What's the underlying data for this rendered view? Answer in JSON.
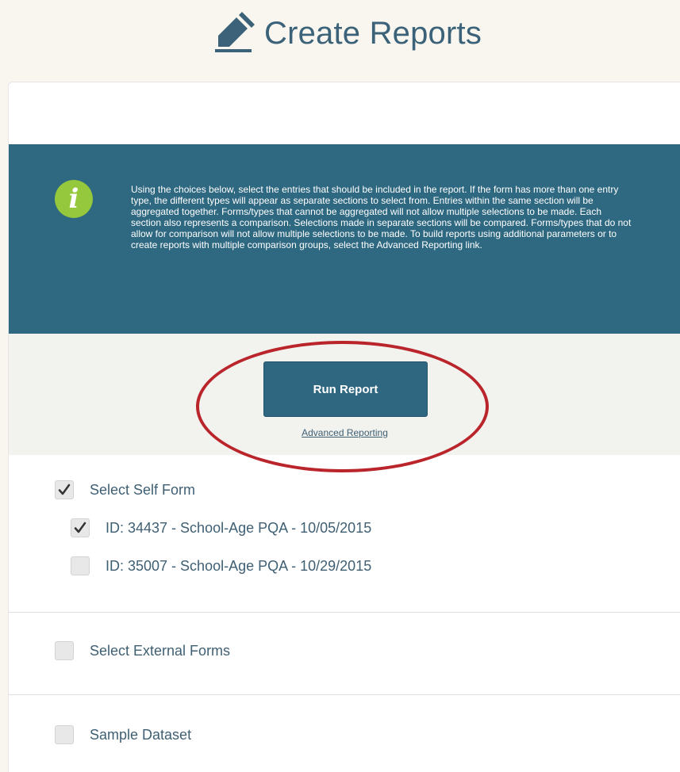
{
  "header": {
    "title": "Create Reports",
    "icon": "pencil-icon"
  },
  "info_box": {
    "icon": "info-icon",
    "icon_glyph": "i",
    "text": "Using the choices below, select the entries that should be included in the report. If the form has more than one entry type, the different types will appear as separate sections to select from. Entries within the same section will be aggregated together. Forms/types that cannot be aggregated will not allow multiple selections to be made. Each section also represents a comparison. Selections made in separate sections will be compared. Forms/types that do not allow for comparison will not allow multiple selections to be made. To build reports using additional parameters or to create reports with multiple comparison groups, select the Advanced Reporting link."
  },
  "actions": {
    "run_report_label": "Run Report",
    "advanced_reporting_label": "Advanced Reporting"
  },
  "sections": {
    "self_form": {
      "label": "Select Self Form",
      "checked": true,
      "items": [
        {
          "label": "ID: 34437 - School-Age PQA - 10/05/2015",
          "checked": true
        },
        {
          "label": "ID: 35007 - School-Age PQA - 10/29/2015",
          "checked": false
        }
      ]
    },
    "external_forms": {
      "label": "Select External Forms",
      "checked": false
    },
    "sample_dataset": {
      "label": "Sample Dataset",
      "checked": false
    }
  },
  "colors": {
    "brand_blue": "#2e6881",
    "info_green": "#95c83d",
    "highlight_red": "#b9252b",
    "text_blue": "#3f5f73"
  }
}
